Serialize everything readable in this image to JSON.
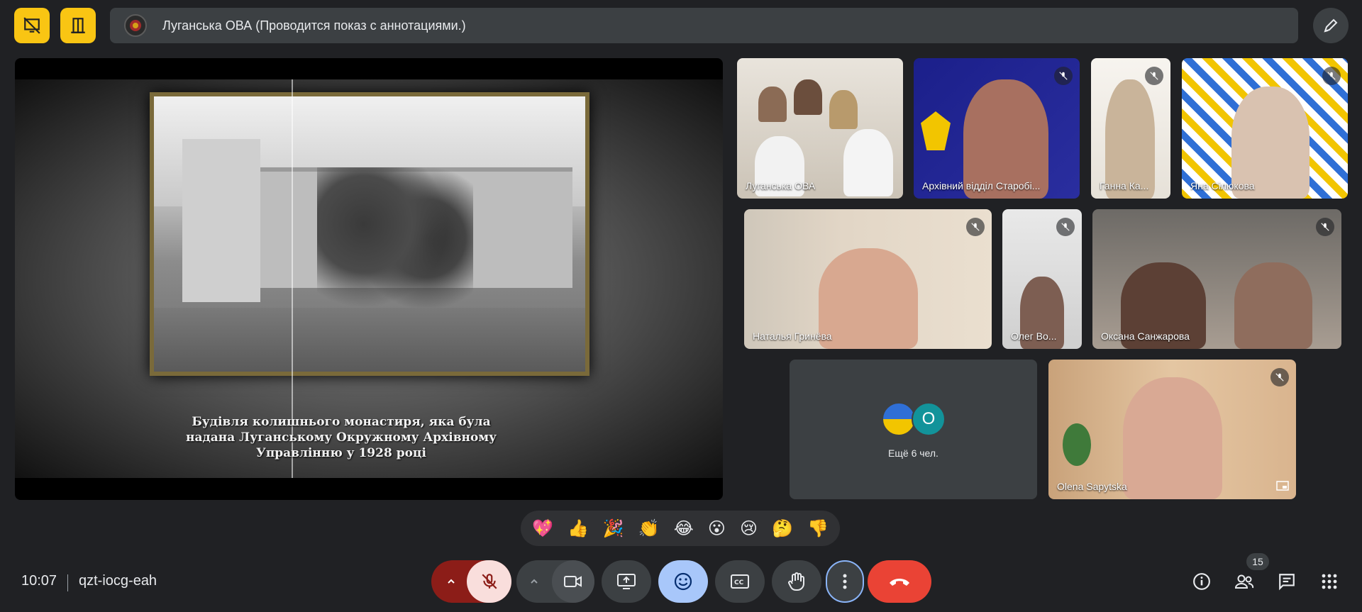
{
  "banner": {
    "title": "Луганська ОВА (Проводится показ с аннотациями.)"
  },
  "presentation": {
    "caption_line1": "Будівля колишнього монастиря, яка була",
    "caption_line2": "надана Луганському Окружному Архівному",
    "caption_line3": "Управлінню у 1928 році"
  },
  "participants": [
    {
      "name": "Луганська ОВА",
      "muted": false
    },
    {
      "name": "Архівний відділ Старобі...",
      "muted": true
    },
    {
      "name": "Ганна Ка...",
      "muted": true
    },
    {
      "name": "Яна Сілюкова",
      "muted": true
    },
    {
      "name": "Наталья Гринёва",
      "muted": true
    },
    {
      "name": "Олег Во...",
      "muted": true
    },
    {
      "name": "Оксана Санжарова",
      "muted": true
    },
    {
      "name": "Olena Sapytska",
      "muted": true
    }
  ],
  "more_tile": {
    "avatar_letter": "O",
    "label": "Ещё 6 чел."
  },
  "reactions": [
    "💖",
    "👍",
    "🎉",
    "👏",
    "😂",
    "😮",
    "😢",
    "🤔",
    "👎"
  ],
  "meeting": {
    "time": "10:07",
    "code": "qzt-iocg-eah",
    "participant_count": "15"
  },
  "colors": {
    "accent_yellow": "#f9c513",
    "end_call_red": "#ea4335",
    "mic_off_bg": "#f9dedc",
    "emoji_btn_bg": "#a8c7fa",
    "dark_red": "#8c1d18"
  }
}
